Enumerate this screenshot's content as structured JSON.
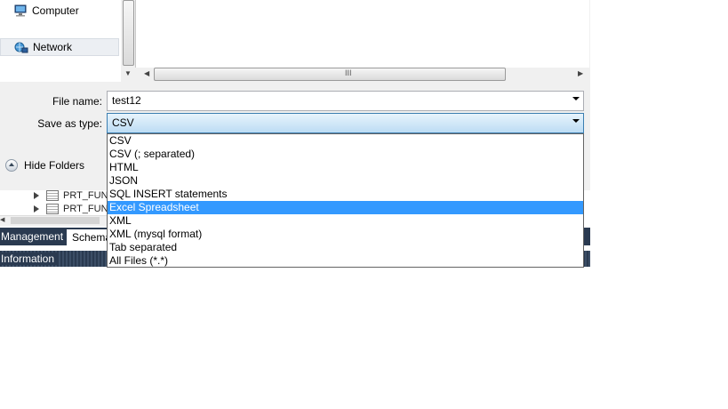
{
  "nav": {
    "computer": "Computer",
    "network": "Network"
  },
  "form": {
    "file_name_label": "File name:",
    "file_name_value": "test12",
    "save_type_label": "Save as type:",
    "save_type_value": "CSV"
  },
  "hide_folders": "Hide Folders",
  "scroll_grip": "III",
  "file_types": [
    "CSV",
    "CSV (; separated)",
    "HTML",
    "JSON",
    "SQL INSERT statements",
    "Excel Spreadsheet",
    "XML",
    "XML (mysql format)",
    "Tab separated",
    "All Files (*.*)"
  ],
  "highlighted_type": "Excel Spreadsheet",
  "app": {
    "tree_rows": [
      "PRT_FUN",
      "PRT_FUNI"
    ],
    "tabs": [
      "Management",
      "Schema"
    ],
    "info_label": "Information"
  },
  "colors": {
    "selection": "#3399ff",
    "app_bar": "#2a3a50"
  }
}
